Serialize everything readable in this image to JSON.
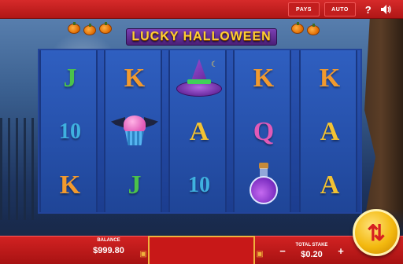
{
  "game": {
    "title": "LUCKY HALLOWEEN"
  },
  "topbar": {
    "pays_label": "PAYS",
    "auto_label": "AUTO",
    "help_label": "?"
  },
  "reels": [
    [
      {
        "type": "letter",
        "value": "J",
        "cls": "c-J"
      },
      {
        "type": "letter",
        "value": "10",
        "cls": "c-10"
      },
      {
        "type": "letter",
        "value": "K",
        "cls": "c-K"
      }
    ],
    [
      {
        "type": "letter",
        "value": "K",
        "cls": "c-K"
      },
      {
        "type": "symbol",
        "value": "bat-cupcake-icon"
      },
      {
        "type": "letter",
        "value": "J",
        "cls": "c-J"
      }
    ],
    [
      {
        "type": "symbol",
        "value": "witch-hat-icon"
      },
      {
        "type": "letter",
        "value": "A",
        "cls": "c-A"
      },
      {
        "type": "letter",
        "value": "10",
        "cls": "c-10"
      }
    ],
    [
      {
        "type": "letter",
        "value": "K",
        "cls": "c-K"
      },
      {
        "type": "letter",
        "value": "Q",
        "cls": "c-Q"
      },
      {
        "type": "symbol",
        "value": "potion-icon"
      }
    ],
    [
      {
        "type": "letter",
        "value": "K",
        "cls": "c-K"
      },
      {
        "type": "letter",
        "value": "A",
        "cls": "c-A"
      },
      {
        "type": "letter",
        "value": "A",
        "cls": "c-A"
      }
    ]
  ],
  "footer": {
    "balance_label": "BALANCE",
    "balance_value": "$999.80",
    "stake_label": "TOTAL STAKE",
    "stake_value": "$0.20",
    "minus_label": "−",
    "plus_label": "+"
  },
  "colors": {
    "bar_red": "#d22222",
    "reel_blue": "#2752ad",
    "title_gold": "#ffcf33",
    "spin_gold": "#f3b90f"
  }
}
